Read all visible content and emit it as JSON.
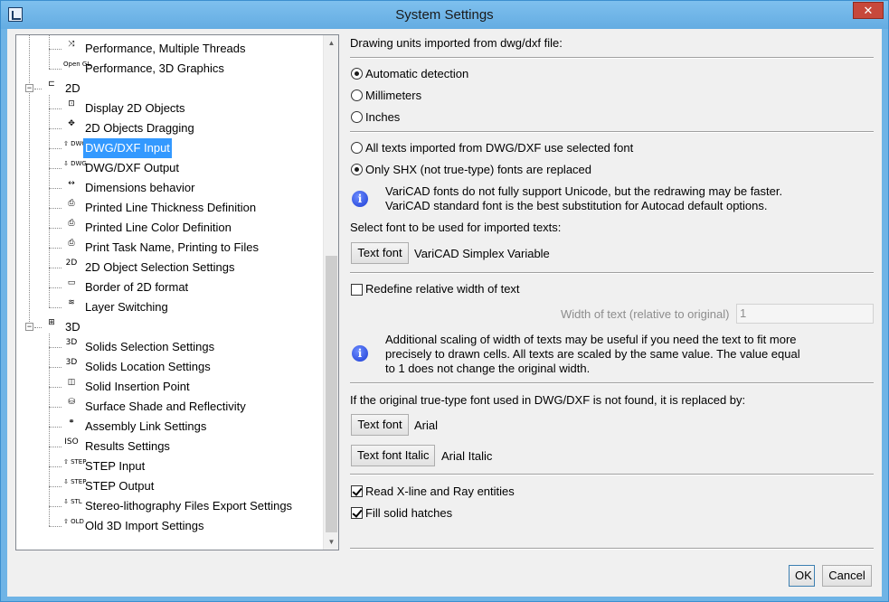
{
  "window": {
    "title": "System Settings",
    "close_label": "✕"
  },
  "tree": {
    "items": [
      {
        "label": "Performance, Multiple Threads",
        "icon": "threads-icon",
        "glyph": "⤨",
        "level": 2,
        "selected": false
      },
      {
        "label": "Performance, 3D Graphics",
        "icon": "opengl-icon",
        "glyph": "Open GL",
        "level": 2,
        "selected": false
      },
      {
        "label": "2D",
        "icon": "2d-folder-icon",
        "glyph": "⊏",
        "level": 1,
        "selected": false,
        "expander": "−"
      },
      {
        "label": "Display 2D Objects",
        "icon": "display-2d-icon",
        "glyph": "⊡",
        "level": 2,
        "selected": false
      },
      {
        "label": "2D Objects Dragging",
        "icon": "drag-2d-icon",
        "glyph": "✥",
        "level": 2,
        "selected": false
      },
      {
        "label": "DWG/DXF Input",
        "icon": "dwg-input-icon",
        "glyph": "⇧ DWG",
        "level": 2,
        "selected": true
      },
      {
        "label": "DWG/DXF Output",
        "icon": "dwg-output-icon",
        "glyph": "⇩ DWG",
        "level": 2,
        "selected": false
      },
      {
        "label": "Dimensions behavior",
        "icon": "dimension-icon",
        "glyph": "↔",
        "level": 2,
        "selected": false
      },
      {
        "label": "Printed Line Thickness Definition",
        "icon": "printer-icon",
        "glyph": "⎙",
        "level": 2,
        "selected": false
      },
      {
        "label": "Printed Line Color Definition",
        "icon": "printer-icon",
        "glyph": "⎙",
        "level": 2,
        "selected": false
      },
      {
        "label": "Print Task Name, Printing to Files",
        "icon": "printer-icon",
        "glyph": "⎙",
        "level": 2,
        "selected": false
      },
      {
        "label": "2D Object Selection Settings",
        "icon": "select-2d-icon",
        "glyph": "2D",
        "level": 2,
        "selected": false
      },
      {
        "label": "Border of 2D format",
        "icon": "border-icon",
        "glyph": "▭",
        "level": 2,
        "selected": false
      },
      {
        "label": "Layer Switching",
        "icon": "layers-icon",
        "glyph": "≋",
        "level": 2,
        "selected": false
      },
      {
        "label": "3D",
        "icon": "3d-folder-icon",
        "glyph": "⊞",
        "level": 1,
        "selected": false,
        "expander": "−"
      },
      {
        "label": "Solids Selection Settings",
        "icon": "solids-select-icon",
        "glyph": "3D",
        "level": 2,
        "selected": false
      },
      {
        "label": "Solids Location Settings",
        "icon": "solids-location-icon",
        "glyph": "3D",
        "level": 2,
        "selected": false
      },
      {
        "label": "Solid Insertion Point",
        "icon": "insertion-point-icon",
        "glyph": "◫",
        "level": 2,
        "selected": false
      },
      {
        "label": "Surface Shade and Reflectivity",
        "icon": "shade-icon",
        "glyph": "⛁",
        "level": 2,
        "selected": false
      },
      {
        "label": "Assembly Link Settings",
        "icon": "assembly-icon",
        "glyph": "⚭",
        "level": 2,
        "selected": false
      },
      {
        "label": "Results Settings",
        "icon": "results-icon",
        "glyph": "ISO",
        "level": 2,
        "selected": false
      },
      {
        "label": "STEP Input",
        "icon": "step-input-icon",
        "glyph": "⇧ STEP",
        "level": 2,
        "selected": false
      },
      {
        "label": "STEP Output",
        "icon": "step-output-icon",
        "glyph": "⇩ STEP",
        "level": 2,
        "selected": false
      },
      {
        "label": "Stereo-lithography Files Export Settings",
        "icon": "stl-icon",
        "glyph": "⇩ STL",
        "level": 2,
        "selected": false
      },
      {
        "label": "Old 3D Import Settings",
        "icon": "old-import-icon",
        "glyph": "⇧ OLD",
        "level": 2,
        "selected": false
      }
    ]
  },
  "panel": {
    "units_heading": "Drawing units imported from dwg/dxf file:",
    "units_options": [
      "Automatic detection",
      "Millimeters",
      "Inches"
    ],
    "units_selected": 0,
    "font_options": [
      "All texts imported from DWG/DXF use selected font",
      "Only SHX (not true-type) fonts are replaced"
    ],
    "font_selected": 1,
    "info1_line1": "VariCAD fonts do not fully support Unicode, but the redrawing may be faster.",
    "info1_line2": "VariCAD standard font is the best substitution for Autocad default options.",
    "select_font_label": "Select font to be used for imported texts:",
    "text_font_button": "Text font",
    "text_font_value": "VariCAD Simplex Variable",
    "redefine_width_label": "Redefine relative width of text",
    "redefine_width_checked": false,
    "width_label": "Width of text (relative to original)",
    "width_value": "1",
    "info2_line1": "Additional scaling of width of texts may be useful if you need the text to fit more",
    "info2_line2": "precisely to drawn cells. All texts are scaled by the same value. The value equal",
    "info2_line3": "to 1 does not change the original width.",
    "truetype_label": "If the original true-type font used in DWG/DXF is not found, it is replaced by:",
    "tt_font_button": "Text font",
    "tt_font_value": "Arial",
    "tt_italic_button": "Text font Italic",
    "tt_italic_value": "Arial Italic",
    "read_xline_label": "Read X-line and Ray entities",
    "read_xline_checked": true,
    "fill_hatches_label": "Fill solid hatches",
    "fill_hatches_checked": true
  },
  "footer": {
    "ok_label": "OK",
    "cancel_label": "Cancel"
  }
}
